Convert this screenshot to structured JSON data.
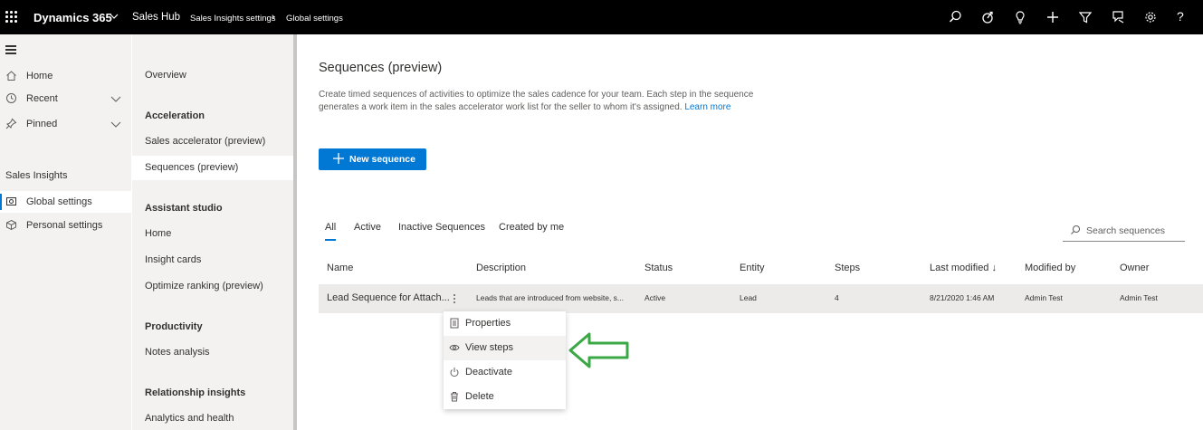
{
  "topbar": {
    "brand": "Dynamics 365",
    "app": "Sales Hub",
    "breadcrumb": [
      "Sales Insights settings",
      "Global settings"
    ],
    "icons": [
      "search-icon",
      "assistant-icon",
      "lightbulb-icon",
      "plus-icon",
      "filter-icon",
      "feedback-icon",
      "gear-icon",
      "help-icon"
    ],
    "help_label": "?"
  },
  "leftnav": {
    "items": [
      {
        "label": "Home",
        "icon": "home-icon"
      },
      {
        "label": "Recent",
        "icon": "clock-icon"
      },
      {
        "label": "Pinned",
        "icon": "pin-icon"
      }
    ],
    "section": "Sales Insights",
    "sub_items": [
      {
        "label": "Global settings",
        "icon": "global-settings-icon",
        "selected": true
      },
      {
        "label": "Personal settings",
        "icon": "personal-settings-icon",
        "selected": false
      }
    ]
  },
  "subnav": {
    "overview": "Overview",
    "groups": [
      {
        "heading": "Acceleration",
        "items": [
          "Sales accelerator (preview)",
          "Sequences (preview)"
        ]
      },
      {
        "heading": "Assistant studio",
        "items": [
          "Home",
          "Insight cards",
          "Optimize ranking (preview)"
        ]
      },
      {
        "heading": "Productivity",
        "items": [
          "Notes analysis"
        ]
      },
      {
        "heading": "Relationship insights",
        "items": [
          "Analytics and health"
        ]
      }
    ],
    "selected": "Sequences (preview)"
  },
  "main": {
    "title": "Sequences (preview)",
    "description_line1": "Create timed sequences of activities to optimize the sales cadence for your team. Each step in the sequence",
    "description_line2": "generates a work item in the sales accelerator work list for the seller to whom it's assigned.",
    "learn_more": "Learn more",
    "new_button": "New sequence",
    "tabs": [
      "All",
      "Active",
      "Inactive Sequences",
      "Created by me"
    ],
    "selected_tab": "All",
    "search_placeholder": "Search sequences",
    "columns": [
      "Name",
      "Description",
      "Status",
      "Entity",
      "Steps",
      "Last modified ↓",
      "Modified by",
      "Owner"
    ],
    "rows": [
      {
        "name": "Lead Sequence for Attach...",
        "description": "Leads that are introduced from website, s...",
        "status": "Active",
        "entity": "Lead",
        "steps": "4",
        "last_modified": "8/21/2020 1:46 AM",
        "modified_by": "Admin Test",
        "owner": "Admin Test"
      }
    ],
    "context_menu": [
      {
        "label": "Properties",
        "icon": "properties-icon"
      },
      {
        "label": "View steps",
        "icon": "eye-icon",
        "highlighted": true
      },
      {
        "label": "Deactivate",
        "icon": "power-icon"
      },
      {
        "label": "Delete",
        "icon": "trash-icon"
      }
    ]
  },
  "colors": {
    "accent": "#0078d4",
    "topbar": "#000000",
    "nav_bg": "#f3f2f1",
    "annotation_arrow": "#3aa845"
  }
}
